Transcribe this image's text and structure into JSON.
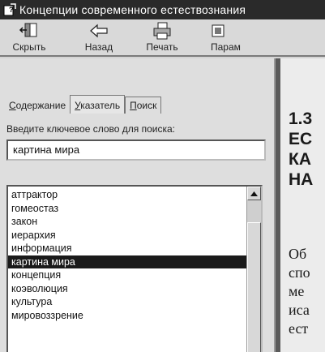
{
  "window": {
    "title": "Концепции современного естествознания"
  },
  "toolbar": {
    "hide_label": "Скрыть",
    "back_label": "Назад",
    "print_label": "Печать",
    "params_label": "Парам"
  },
  "tabs": [
    {
      "label_accel": "С",
      "label_rest": "одержание"
    },
    {
      "label_accel": "У",
      "label_rest": "казатель"
    },
    {
      "label_accel": "П",
      "label_rest": "оиск"
    }
  ],
  "search": {
    "prompt": "Введите ключевое слово для поиска:",
    "value": "картина мира"
  },
  "keywords": [
    "аттрактор",
    "гомеостаз",
    "закон",
    "иерархия",
    "информация",
    "картина мира",
    "концепция",
    "коэволюция",
    "культура",
    "мировоззрение"
  ],
  "selected_keyword": "картина мира",
  "content": {
    "heading": "1.3\nЕС\nКА\nНА",
    "body": "Об\nспо\nме\nиса\nест"
  }
}
